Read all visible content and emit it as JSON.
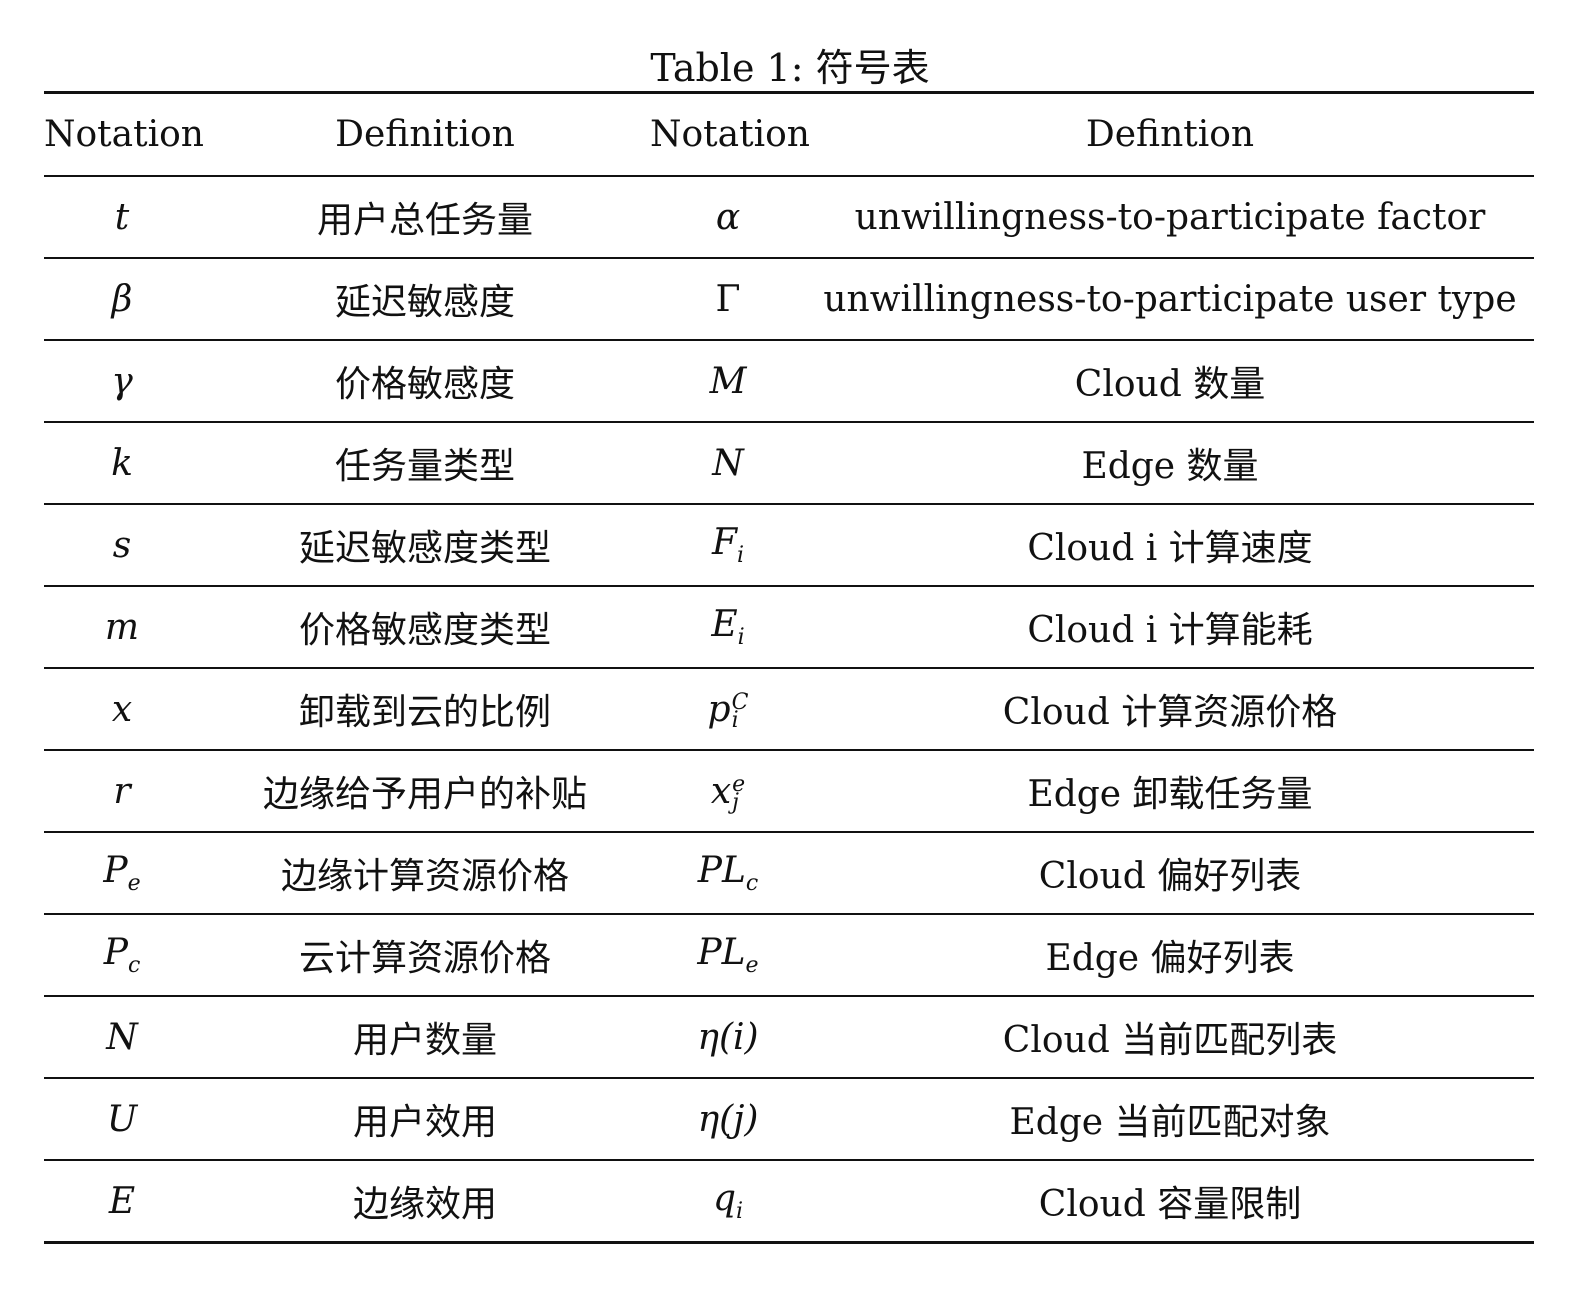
{
  "caption": "Table 1: 符号表",
  "headers": [
    "Notation",
    "Definition",
    "Notation",
    "Defintion"
  ],
  "rows": [
    {
      "left_symbol": "t",
      "left_def": "用户总任务量",
      "right_symbol": "α",
      "right_def": "unwillingness-to-participate factor"
    },
    {
      "left_symbol": "β",
      "left_def": "延迟敏感度",
      "right_symbol": "Γ",
      "right_def": "unwillingness-to-participate user type"
    },
    {
      "left_symbol": "γ",
      "left_def": "价格敏感度",
      "right_symbol": "M",
      "right_def": "Cloud 数量"
    },
    {
      "left_symbol": "k",
      "left_def": "任务量类型",
      "right_symbol": "N",
      "right_def": "Edge 数量"
    },
    {
      "left_symbol": "s",
      "left_def": "延迟敏感度类型",
      "right_symbol": "F",
      "right_def": "Cloud i 计算速度"
    },
    {
      "left_symbol": "m",
      "left_def": "价格敏感度类型",
      "right_symbol": "E",
      "right_def": "Cloud i 计算能耗"
    },
    {
      "left_symbol": "x",
      "left_def": "卸载到云的比例",
      "right_symbol": "p",
      "right_def": "Cloud 计算资源价格"
    },
    {
      "left_symbol": "r",
      "left_def": "边缘给予用户的补贴",
      "right_symbol": "x",
      "right_def": "Edge 卸载任务量"
    },
    {
      "left_symbol": "P",
      "left_def": "边缘计算资源价格",
      "right_symbol": "PL",
      "right_def": "Cloud 偏好列表"
    },
    {
      "left_symbol": "P",
      "left_def": "云计算资源价格",
      "right_symbol": "PL",
      "right_def": "Edge 偏好列表"
    },
    {
      "left_symbol": "N",
      "left_def": "用户数量",
      "right_symbol": "η(i)",
      "right_def": "Cloud 当前匹配列表"
    },
    {
      "left_symbol": "U",
      "left_def": "用户效用",
      "right_symbol": "η(j)",
      "right_def": "Edge 当前匹配对象"
    },
    {
      "left_symbol": "E",
      "left_def": "边缘效用",
      "right_symbol": "q",
      "right_def": "Cloud 容量限制"
    }
  ],
  "scripts": {
    "Fi_sub": "i",
    "Ei_sub": "i",
    "pCi_sup": "C",
    "pCi_sub": "i",
    "xej_sup": "e",
    "xej_sub": "j",
    "Pe_sub": "e",
    "Pc_sub": "c",
    "PLc_sub": "c",
    "PLe_sub": "e",
    "qi_sub": "i"
  }
}
